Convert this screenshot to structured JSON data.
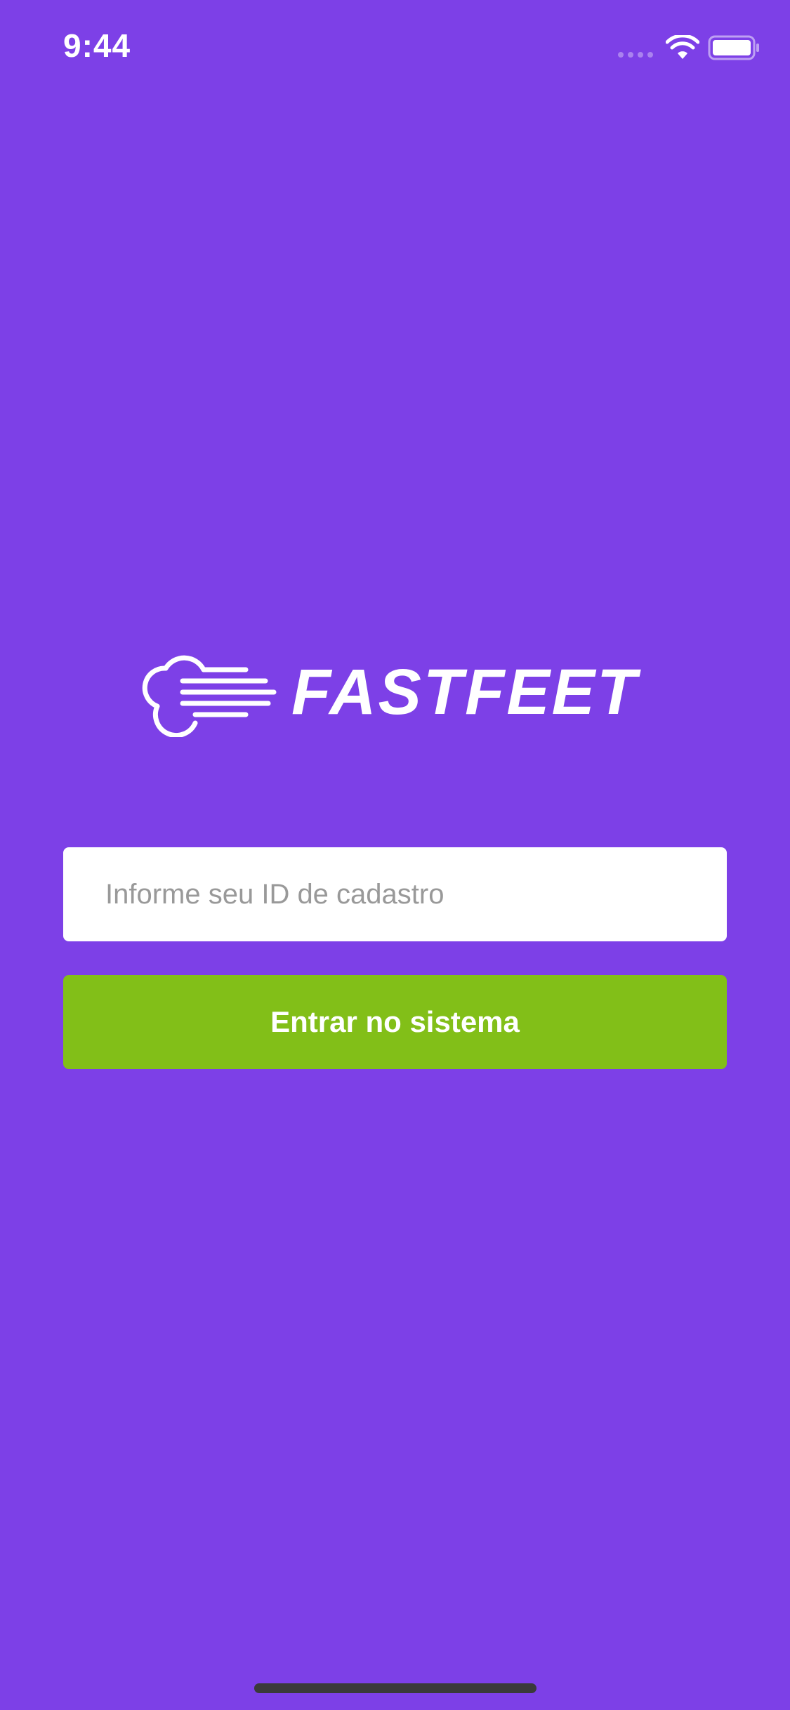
{
  "status_bar": {
    "time": "9:44"
  },
  "brand": {
    "name": "FASTFEET",
    "logo_icon": "wind-cloud-icon"
  },
  "login": {
    "id_placeholder": "Informe seu ID de cadastro",
    "id_value": "",
    "submit_label": "Entrar no sistema"
  },
  "colors": {
    "background": "#7d40e7",
    "accent_button": "#82bf18",
    "input_bg": "#ffffff",
    "placeholder": "#999999"
  }
}
